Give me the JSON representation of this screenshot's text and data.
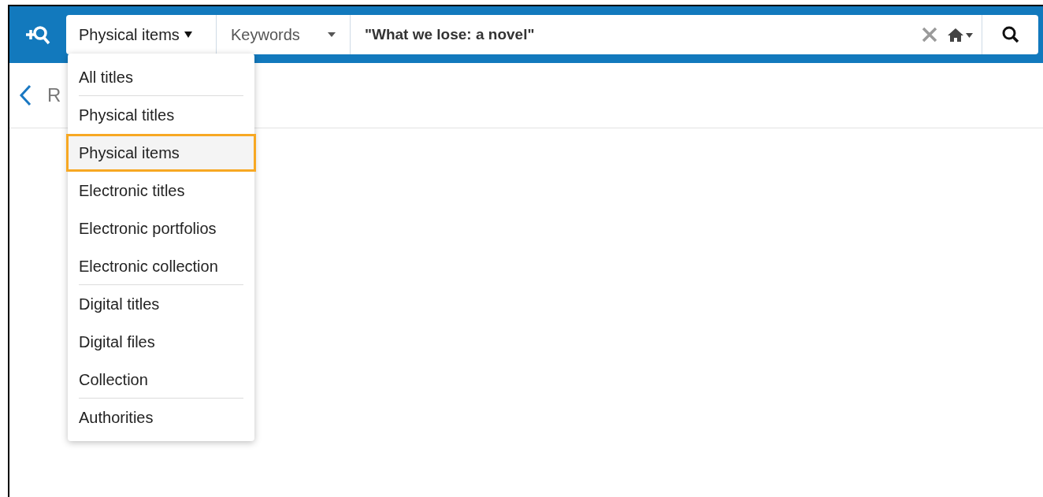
{
  "search_bar": {
    "scope": "Physical items",
    "field": "Keywords",
    "query": "\"What we lose: a novel\""
  },
  "page_header": {
    "back_label": "R"
  },
  "scope_menu": {
    "items": [
      {
        "label": "All titles",
        "selected": false,
        "divider_after": true
      },
      {
        "label": "Physical titles",
        "selected": false,
        "divider_after": false
      },
      {
        "label": "Physical items",
        "selected": true,
        "divider_after": false
      },
      {
        "label": "Electronic titles",
        "selected": false,
        "divider_after": false
      },
      {
        "label": "Electronic portfolios",
        "selected": false,
        "divider_after": false
      },
      {
        "label": "Electronic collection",
        "selected": false,
        "divider_after": true
      },
      {
        "label": "Digital titles",
        "selected": false,
        "divider_after": false
      },
      {
        "label": "Digital files",
        "selected": false,
        "divider_after": false
      },
      {
        "label": "Collection",
        "selected": false,
        "divider_after": true
      },
      {
        "label": "Authorities",
        "selected": false,
        "divider_after": false
      }
    ]
  }
}
